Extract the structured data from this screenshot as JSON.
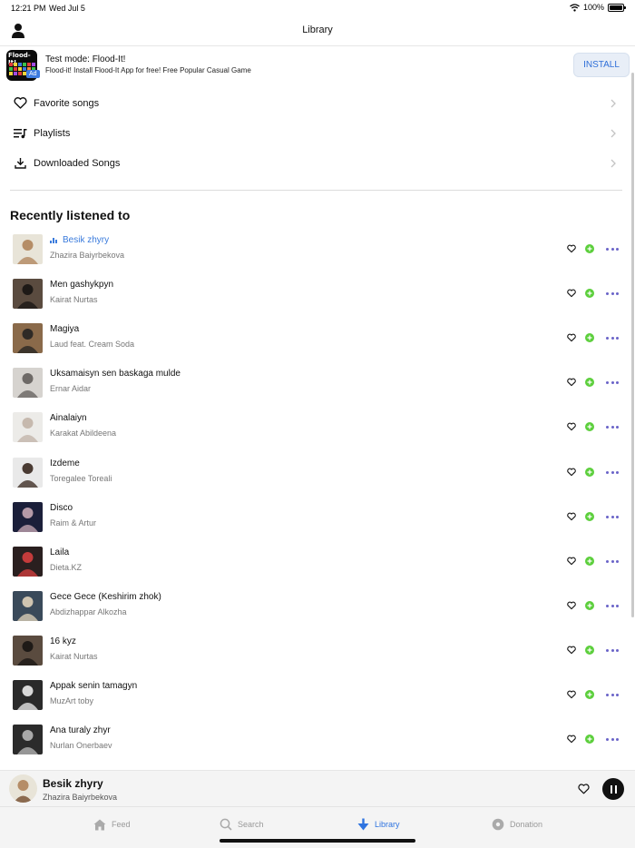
{
  "status_bar": {
    "time": "12:21 PM",
    "date": "Wed Jul 5",
    "battery": "100%"
  },
  "header": {
    "title": "Library"
  },
  "ad": {
    "icon_text": "Flood-It!",
    "badge": "Ad",
    "title": "Test mode: Flood-It!",
    "description": "Flood-it! Install Flood-It App for free! Free Popular Casual Game",
    "install_label": "INSTALL"
  },
  "menu": [
    {
      "label": "Favorite songs",
      "icon": "heart-icon"
    },
    {
      "label": "Playlists",
      "icon": "playlist-icon"
    },
    {
      "label": "Downloaded Songs",
      "icon": "download-icon"
    }
  ],
  "recent": {
    "title": "Recently listened to",
    "songs": [
      {
        "title": "Besik zhyry",
        "artist": "Zhazira Baiyrbekova",
        "playing": true,
        "cover_colors": [
          "#e8e4d8",
          "#b58d67"
        ]
      },
      {
        "title": "Men gashykpyn",
        "artist": "Kairat Nurtas",
        "playing": false,
        "cover_colors": [
          "#5a4b3f",
          "#1e1a17"
        ]
      },
      {
        "title": "Magiya",
        "artist": "Laud feat. Cream Soda",
        "playing": false,
        "cover_colors": [
          "#8a6a4a",
          "#2e2a26"
        ]
      },
      {
        "title": "Uksamaisyn sen baskaga mulde",
        "artist": "Ernar Aidar",
        "playing": false,
        "cover_colors": [
          "#d6d3cf",
          "#6e6a67"
        ]
      },
      {
        "title": "Ainalaiyn",
        "artist": "Karakat Abildeena",
        "playing": false,
        "cover_colors": [
          "#ecebe8",
          "#c6b9ae"
        ]
      },
      {
        "title": "Izdeme",
        "artist": "Toregalee Toreali",
        "playing": false,
        "cover_colors": [
          "#e9e9e9",
          "#4a3b33"
        ]
      },
      {
        "title": "Disco",
        "artist": "Raim & Artur",
        "playing": false,
        "cover_colors": [
          "#1b1f3a",
          "#b59aa8"
        ]
      },
      {
        "title": "Laila",
        "artist": "Dieta.KZ",
        "playing": false,
        "cover_colors": [
          "#2a1f1f",
          "#c43b3b"
        ]
      },
      {
        "title": "Gece Gece (Keshirim zhok)",
        "artist": "Abdizhappar Alkozha",
        "playing": false,
        "cover_colors": [
          "#3a4a5a",
          "#cfc4b0"
        ]
      },
      {
        "title": "16 kyz",
        "artist": "Kairat Nurtas",
        "playing": false,
        "cover_colors": [
          "#5a4b3f",
          "#1e1a17"
        ]
      },
      {
        "title": "Appak senin tamagyn",
        "artist": "MuzArt toby",
        "playing": false,
        "cover_colors": [
          "#2a2a2a",
          "#d8d8d8"
        ]
      },
      {
        "title": "Ana turaly zhyr",
        "artist": "Nurlan Onerbaev",
        "playing": false,
        "cover_colors": [
          "#2b2b2b",
          "#a9a9a9"
        ]
      }
    ]
  },
  "player": {
    "title": "Besik zhyry",
    "artist": "Zhazira Baiyrbekova"
  },
  "tabs": [
    {
      "label": "Feed",
      "icon": "home-icon",
      "active": false
    },
    {
      "label": "Search",
      "icon": "search-icon",
      "active": false
    },
    {
      "label": "Library",
      "icon": "library-icon",
      "active": true
    },
    {
      "label": "Donation",
      "icon": "donation-icon",
      "active": false
    }
  ],
  "colors": {
    "accent": "#2f74e0",
    "plus": "#5ccf3c",
    "more_dots": "#6a63c8"
  }
}
